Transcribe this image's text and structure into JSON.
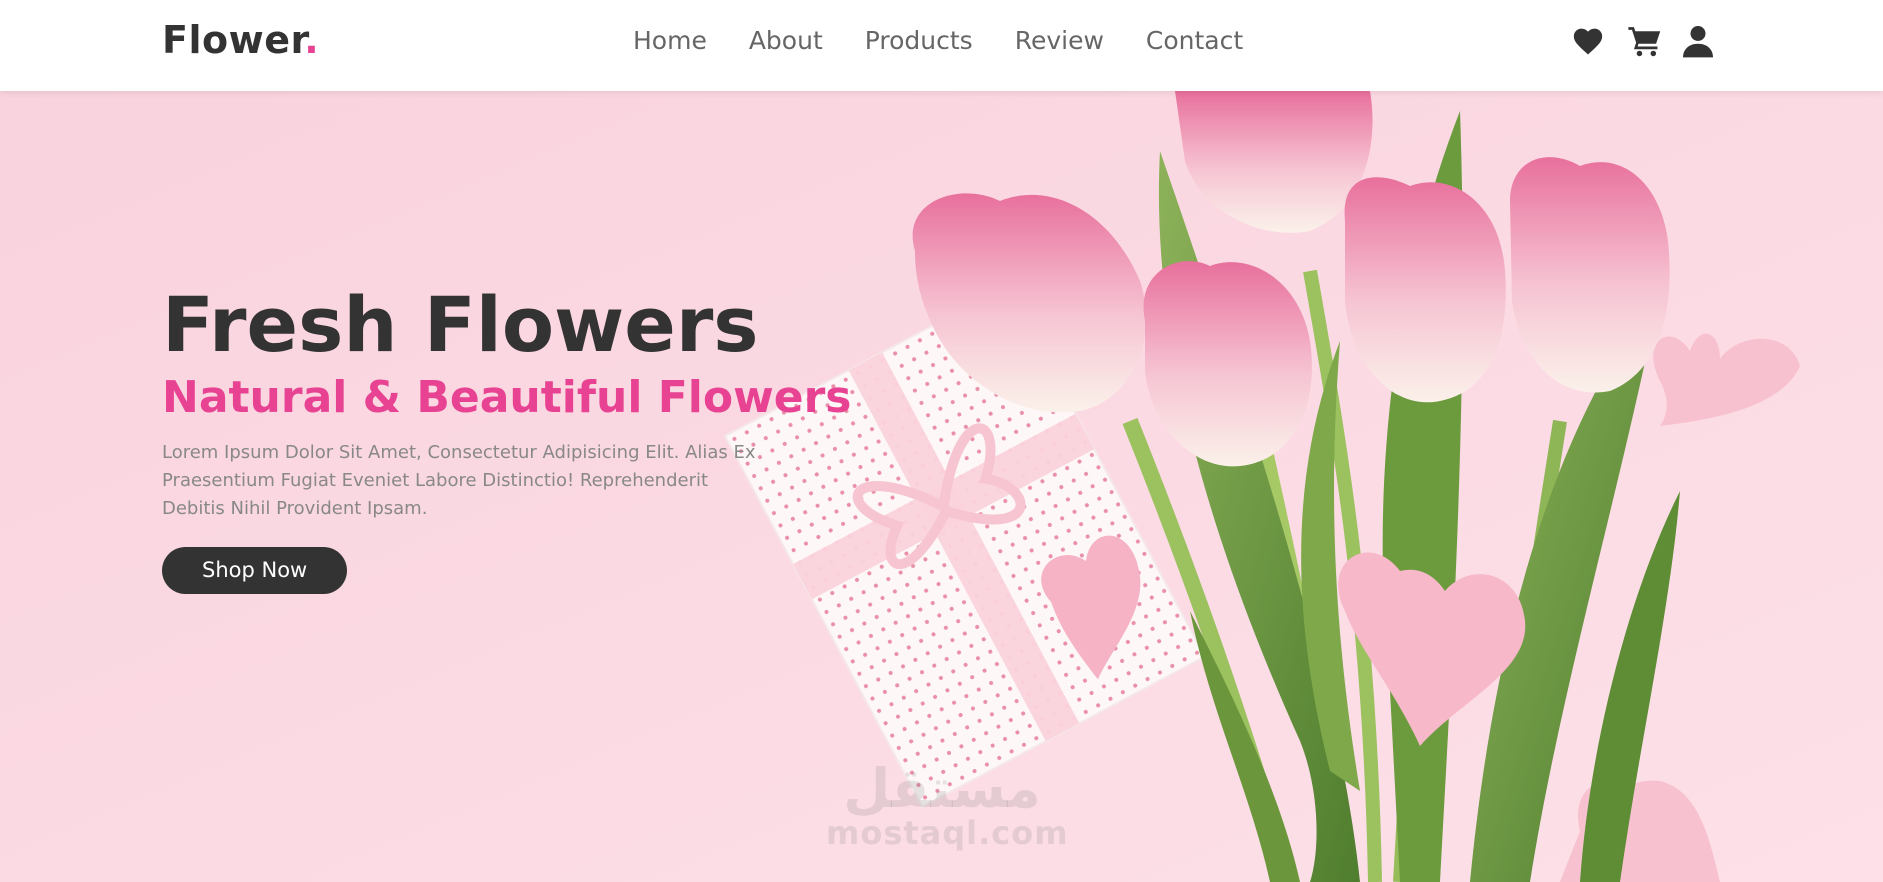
{
  "header": {
    "logo_text": "Flower",
    "logo_dot": ".",
    "nav": [
      {
        "label": "Home"
      },
      {
        "label": "About"
      },
      {
        "label": "Products"
      },
      {
        "label": "Review"
      },
      {
        "label": "Contact"
      }
    ],
    "icons": [
      "heart-icon",
      "cart-icon",
      "user-icon"
    ]
  },
  "hero": {
    "title": "Fresh Flowers",
    "subtitle": "Natural & Beautiful Flowers",
    "description": "Lorem Ipsum Dolor Sit Amet, Consectetur Adipisicing Elit. Alias Ex Praesentium Fugiat Eveniet Labore Distinctio! Reprehenderit Debitis Nihil Provident Ipsam.",
    "button_label": "Shop Now"
  },
  "watermark": {
    "arabic": "مستقل",
    "latin": "mostaql.com"
  },
  "colors": {
    "accent": "#e84393",
    "dark": "#333333",
    "background": "#fbd8e2"
  }
}
